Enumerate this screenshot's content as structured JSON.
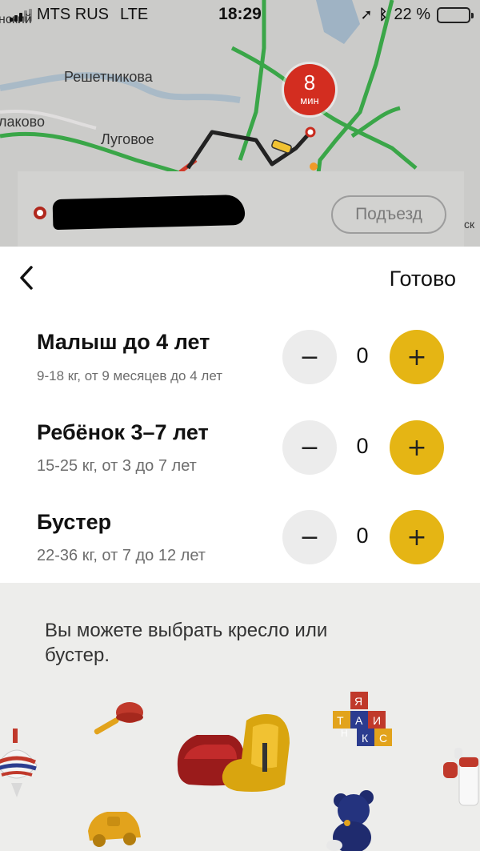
{
  "status_bar": {
    "carrier": "MTS RUS",
    "network": "LTE",
    "time": "18:29",
    "battery": "22 %",
    "battery_level": 0.22
  },
  "map": {
    "labels": [
      "Решетникова",
      "лаково",
      "Луговое",
      "нский",
      "ск"
    ],
    "eta": {
      "value": "8",
      "unit": "мин"
    },
    "entrance_button": "Подъезд"
  },
  "sheet": {
    "done_label": "Готово",
    "back_icon": "‹",
    "seats": [
      {
        "title": "Малыш до 4 лет",
        "subtitle": "9-18 кг, от 9 месяцев до 4 лет",
        "count": "0"
      },
      {
        "title": "Ребёнок 3–7 лет",
        "subtitle": "15-25 кг, от 3 до 7 лет",
        "count": "0"
      },
      {
        "title": "Бустер",
        "subtitle": "22-36 кг, от 7 до 12 лет",
        "count": "0"
      }
    ],
    "minus_symbol": "−",
    "plus_symbol": "+"
  },
  "info": {
    "text": "Вы можете выбрать кресло или бустер.",
    "blocks_letters": [
      "Я",
      "Т",
      "А",
      "И",
      "Н",
      "К",
      "С"
    ]
  },
  "colors": {
    "accent": "#e5b514",
    "eta_red": "#d32d20",
    "route": "#222222",
    "road_green": "#3aa648"
  }
}
